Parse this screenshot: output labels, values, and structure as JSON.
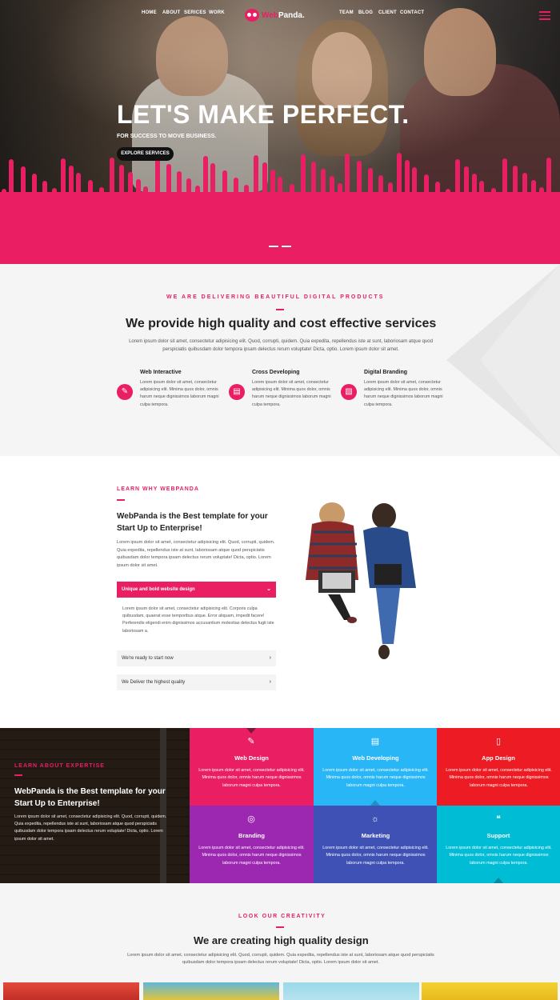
{
  "nav": {
    "left": [
      "HOME",
      "ABOUT",
      "SERICES",
      "WORK"
    ],
    "right": [
      "TEAM",
      "BLOG",
      "CLIENT",
      "CONTACT"
    ],
    "logo_main": "Web",
    "logo_accent": "Panda."
  },
  "hero": {
    "title": "LET'S MAKE PERFECT.",
    "subtitle": "FOR SUCCESS TO MOVE BUSINESS.",
    "button": "EXPLORE SERVICES"
  },
  "services": {
    "eyebrow": "WE ARE DELIVERING BEAUTIFUL DIGITAL PRODUCTS",
    "heading": "We provide high quality and cost effective services",
    "paragraph": "Lorem ipsum dolor sit amet, consectetur adipisicing elit. Quod, corrupti, quidem. Quia expedita, repellendus iste at sunt, laboriosam atque quod perspiciatis quibusdam dolor tempora ipsam delectus rerum voluptate! Dicta, optio. Lorem ipsum dolor sit amet.",
    "items": [
      {
        "title": "Web Interactive",
        "icon": "pencil-ruler-icon",
        "text": "Lorem ipsum dolor sit amet, consectetur adipisicing elit. Minima quos dolor, omnis harum neque dignissimos laborum magni culpa tempora."
      },
      {
        "title": "Cross Developing",
        "icon": "browser-window-icon",
        "text": "Lorem ipsum dolor sit amet, consectetur adipisicing elit. Minima quos dolor, omnis harum neque dignissimos laborum magni culpa tempora."
      },
      {
        "title": "Digital Branding",
        "icon": "presentation-chart-icon",
        "text": "Lorem ipsum dolor sit amet, consectetur adipisicing elit. Minima quos dolor, omnis harum neque dignissimos laborum magni culpa tempora."
      }
    ]
  },
  "why": {
    "eyebrow": "LEARN WHY WEBPANDA",
    "title": "WebPanda is the Best template for your Start Up to Enterprise!",
    "paragraph": "Lorem ipsum dolor sit amet, consectetur adipisicing elit. Quod, corrupti, quidem. Quia expedita, repellendus iste at sunt, laboriosam atque quod perspiciatis quibusdam dolor tempora ipsam delectus rerum voluptate! Dicta, optio. Lorem ipsum dolor sit amet.",
    "accordion_open_title": "Unique and bold website design",
    "accordion_open_body": "Lorem ipsum dolor sit amet, consectetur adipisicing elit. Corporis culpa quibusdam, quaerat esse temporibus atque. Error aliquam, impedit facere! Perferendis eligendi enim dignissimos accusantium molestias delectus fugit iste laboriosam a.",
    "accordion_items": [
      "We're ready to start now",
      "We Deliver the highest quality"
    ]
  },
  "expertise": {
    "eyebrow": "LEARN ABOUT EXPERTISE",
    "title": "WebPanda is the Best template for your Start Up to Enterprise!",
    "paragraph": "Lorem ipsum dolor sit amet, consectetur adipisicing elit. Quod, corrupti, quidem. Quia expedita, repellendus iste at sunt, laboriosam atque quod perspiciatis quibusdam dolor tempora ipsam delectus rerum voluptate! Dicta, optio. Lorem ipsum dolor sit amet.",
    "tiles": [
      {
        "title": "Web Design",
        "icon": "pencil-icon",
        "color": "#e91e63",
        "text": "Lorem ipsum dolor sit amet, consectetur adipisicing elit. Minima quos dolor, omnis harum neque dignissimos laborum magni culpa tempora."
      },
      {
        "title": "Web Developing",
        "icon": "browser-window-icon",
        "color": "#29b6f6",
        "text": "Lorem ipsum dolor sit amet, consectetur adipisicing elit. Minima quos dolor, omnis harum neque dignissimos laborum magni culpa tempora."
      },
      {
        "title": "App Design",
        "icon": "mobile-tablet-icon",
        "color": "#ed1c24",
        "text": "Lorem ipsum dolor sit amet, consectetur adipisicing elit. Minima quos dolor, omnis harum neque dignissimos laborum magni culpa tempora."
      },
      {
        "title": "Branding",
        "icon": "target-icon",
        "color": "#9c27b0",
        "text": "Lorem ipsum dolor sit amet, consectetur adipisicing elit. Minima quos dolor, omnis harum neque dignissimos laborum magni culpa tempora."
      },
      {
        "title": "Marketing",
        "icon": "lightbulb-icon",
        "color": "#3f51b5",
        "text": "Lorem ipsum dolor sit amet, consectetur adipisicing elit. Minima quos dolor, omnis harum neque dignissimos laborum magni culpa tempora."
      },
      {
        "title": "Support",
        "icon": "chat-bubbles-icon",
        "color": "#00bcd4",
        "text": "Lorem ipsum dolor sit amet, consectetur adipisicing elit. Minima quos dolor, omnis harum neque dignissimos laborum magni culpa tempora."
      }
    ]
  },
  "creativity": {
    "eyebrow": "LOOK OUR CREATIVITY",
    "heading": "We are creating high quality design",
    "paragraph": "Lorem ipsum dolor sit amet, consectetur adipisicing elit. Quod, corrupti, quidem. Quia expedita, repellendus iste at sunt, laboriosam atque quod perspiciatis quibusdam dolor tempora ipsam delectus rerum voluptate! Dicta, optio. Lorem ipsum dolor sit amet."
  },
  "colors": {
    "accent": "#e91e63"
  }
}
